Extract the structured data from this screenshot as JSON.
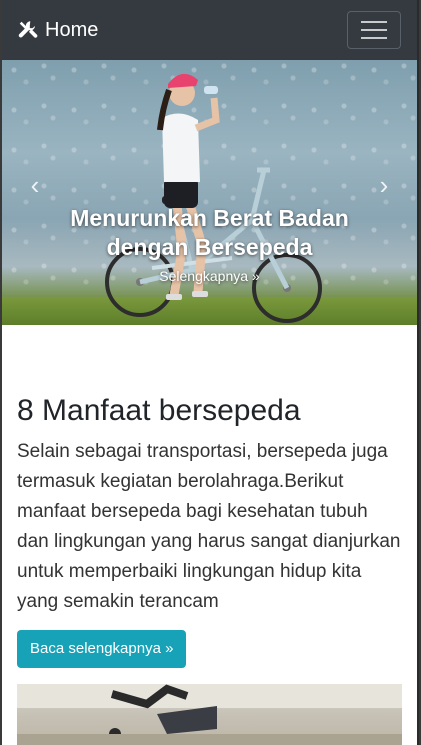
{
  "navbar": {
    "brand": "Home",
    "brand_icon": "tools-icon",
    "toggler_icon": "hamburger-icon"
  },
  "carousel": {
    "title": "Menurunkan Berat Badan dengan Bersepeda",
    "link": "Selengkapnya »",
    "prev_icon": "chevron-left-icon",
    "next_icon": "chevron-right-icon"
  },
  "article": {
    "heading": "8 Manfaat bersepeda",
    "lead": "Selain sebagai transportasi, bersepeda juga termasuk kegiatan berolahraga.Berikut manfaat bersepeda bagi kesehatan tubuh dan lingkungan yang harus sangat dianjurkan untuk memperbaiki lingkungan hidup kita yang semakin terancam",
    "button": "Baca selengkapnya »"
  },
  "colors": {
    "navbar": "#343a40",
    "button": "#17a2b8"
  }
}
